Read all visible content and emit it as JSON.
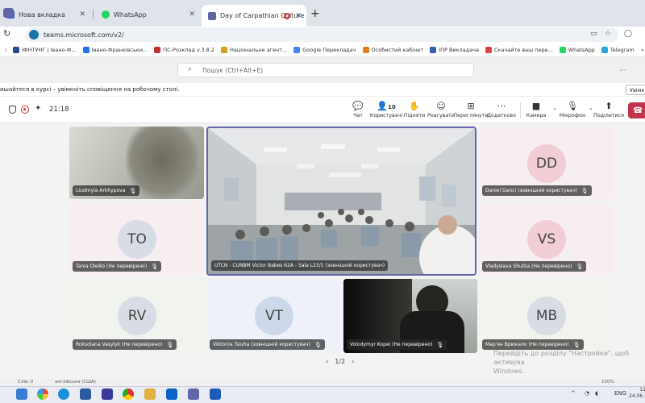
{
  "browser": {
    "tabs": [
      {
        "label": "Нова вкладка",
        "icon_color": "#3c64c8"
      },
      {
        "label": "WhatsApp",
        "icon_color": "#25d366"
      },
      {
        "label": "Day of Carpathian Culture",
        "icon_color": "#6264a7"
      }
    ],
    "url": "teams.microsoft.com/v2/",
    "bookmarks": [
      {
        "label": "ІФНТУНГ | Івано-Ф...",
        "color": "#2a4a8a"
      },
      {
        "label": "Івано-Франківськи...",
        "color": "#1a73e8"
      },
      {
        "label": "ПС-Розклад v.3.8.2",
        "color": "#c03030"
      },
      {
        "label": "Національне агент...",
        "color": "#d0a020"
      },
      {
        "label": "Google Перекладач",
        "color": "#4285f4"
      },
      {
        "label": "Особистий кабінет",
        "color": "#e08020"
      },
      {
        "label": "ІПР Викладача",
        "color": "#3060b0"
      },
      {
        "label": "Скачайте ваш пере...",
        "color": "#e04040"
      },
      {
        "label": "WhatsApp",
        "color": "#25d366"
      },
      {
        "label": "Telegram",
        "color": "#2aa3e0"
      }
    ]
  },
  "teams": {
    "search_placeholder": "Пошук (Ctrl+Alt+E)",
    "notification": "ишайтеся в курсі – увімкніть сповіщення на робочому столі.",
    "notification_button": "Увімк"
  },
  "meeting": {
    "timer": "21:18",
    "tools": [
      {
        "name": "chat",
        "label": "Чат",
        "icon": "💬"
      },
      {
        "name": "people",
        "label": "Користувачі",
        "icon": "👤",
        "count": "10"
      },
      {
        "name": "raise-hand",
        "label": "Підняти",
        "icon": "✋"
      },
      {
        "name": "react",
        "label": "Реагувати",
        "icon": "☺"
      },
      {
        "name": "view",
        "label": "Переглянути",
        "icon": "⊞"
      },
      {
        "name": "more",
        "label": "Додатково",
        "icon": "⋯"
      },
      {
        "name": "camera",
        "label": "Камера",
        "icon": "■"
      },
      {
        "name": "mic",
        "label": "Мікрофон",
        "icon": "🎙"
      },
      {
        "name": "share",
        "label": "Поділитися",
        "icon": "⬆"
      }
    ],
    "participants": [
      {
        "name": "Liudmyla Arkhypova",
        "initials": ""
      },
      {
        "name": "UTCN - CUNBM Victor Babes 62A - Sala L23/1 (зовнішній користувач)",
        "initials": ""
      },
      {
        "name": "Daniel Danci (зовнішній користувач)",
        "initials": "DD"
      },
      {
        "name": "Tania Oleiko (Не перевірено)",
        "initials": "TO"
      },
      {
        "name": "Vladyslava Shutka (Не перевірено)",
        "initials": "VS"
      },
      {
        "name": "Roksolana Vasylyk (Не перевірено)",
        "initials": "RV"
      },
      {
        "name": "Viktoriia Tsiuha (зовнішній користувач)",
        "initials": "VT"
      },
      {
        "name": "Volodymyr Kopei (Не перевірено)",
        "initials": ""
      },
      {
        "name": "Мар'ян Врюкало (Не перевірено)",
        "initials": "MB"
      }
    ],
    "pager": "1/2"
  },
  "windows": {
    "watermark_line1": "Перейдіть до розділу \"Настройки\", щоб активува",
    "watermark_line2": "Windows.",
    "status_left": "Слів: 0",
    "status_lang": "англійська (США)",
    "zoom": "100%",
    "lang": "ENG",
    "time": "11:",
    "date": "24.06.2"
  }
}
